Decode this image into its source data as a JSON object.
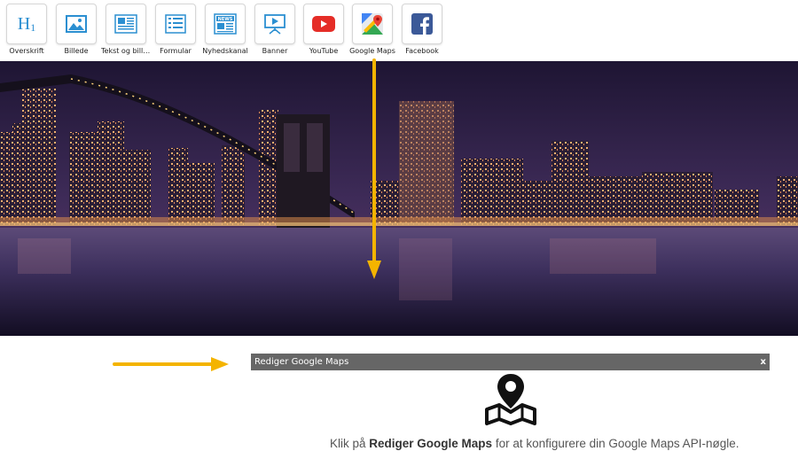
{
  "toolbar": {
    "items": [
      {
        "label": "Overskrift",
        "icon": "heading-icon"
      },
      {
        "label": "Billede",
        "icon": "image-icon"
      },
      {
        "label": "Tekst og bille...",
        "icon": "text-and-image-icon"
      },
      {
        "label": "Formular",
        "icon": "form-icon"
      },
      {
        "label": "Nyhedskanal",
        "icon": "news-icon"
      },
      {
        "label": "Banner",
        "icon": "banner-icon"
      },
      {
        "label": "YouTube",
        "icon": "youtube-icon"
      },
      {
        "label": "Google Maps",
        "icon": "google-maps-icon"
      },
      {
        "label": "Facebook",
        "icon": "facebook-icon"
      }
    ],
    "heading_glyph": "H1",
    "news_glyph": "NEWS"
  },
  "editor": {
    "title": "Rediger Google Maps",
    "close": "x"
  },
  "hint": {
    "prefix": "Klik på ",
    "bold": "Rediger Google Maps",
    "suffix": " for at konfigurere din Google Maps API-nøgle."
  },
  "colors": {
    "accent_arrow": "#f4b400",
    "icon_blue": "#2b8fd1",
    "youtube_red": "#e52d27",
    "facebook_blue": "#3b5998",
    "editbar_bg": "#666666"
  }
}
